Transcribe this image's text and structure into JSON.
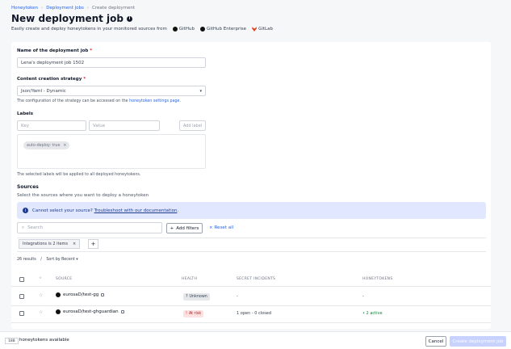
{
  "breadcrumb": {
    "items": [
      "Honeytoken",
      "Deployment jobs",
      "Create deployment"
    ]
  },
  "page": {
    "title": "New deployment job",
    "subtitle": "Easily create and deploy honeytokens in your monitored sources from",
    "sources": [
      "GitHub",
      "GitHub Enterprise",
      "GitLab"
    ]
  },
  "form": {
    "name_label": "Name of the deployment job",
    "name_value": "Lena's deployment job 1502",
    "strategy_label": "Content creation strategy",
    "strategy_value": "Json/Yaml - Dynamic",
    "strategy_helper": "The configuration of the strategy can be accessed on the",
    "strategy_helper_link": "honeytoken settings page.",
    "labels_title": "Labels",
    "key_placeholder": "Key",
    "value_placeholder": "Value",
    "add_label": "Add label",
    "chip": "auto-deploy: true",
    "labels_helper": "The selected labels will be applied to all deployed honeytokens."
  },
  "sources_section": {
    "title": "Sources",
    "description": "Select the sources where you want to deploy a honeytoken",
    "banner_text": "Cannot select your source?",
    "banner_link": "Troubleshoot with our documentation",
    "search_placeholder": "Search",
    "add_filters": "Add filters",
    "reset_all": "Reset all",
    "filter_chip": "Integrations is 2 items",
    "results": "26 results",
    "sort_by": "Sort by Recent"
  },
  "table": {
    "headers": [
      "Source",
      "Health",
      "Secret incidents",
      "Honeytokens"
    ],
    "rows": [
      {
        "source": "eurosaD/test-gg",
        "health": "Unknown",
        "incidents": "-",
        "honeytokens": "-"
      },
      {
        "source": "eurosaD/test-ghguardian",
        "health": "At risk",
        "incidents": "1 open - 0 closed",
        "honeytokens": "2 active"
      }
    ]
  },
  "footer": {
    "count": "188",
    "available": "honeytokens available",
    "cancel": "Cancel",
    "create": "Create deployment job"
  }
}
